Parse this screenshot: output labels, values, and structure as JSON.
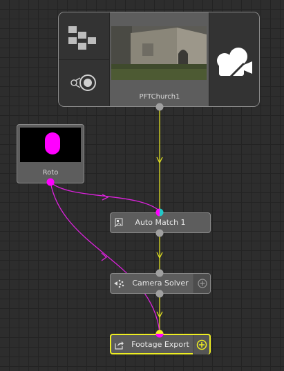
{
  "nodes": {
    "clip": {
      "label": "PFTChurch1"
    },
    "roto": {
      "label": "Roto"
    },
    "auto_match": {
      "label": "Auto Match 1"
    },
    "camera_solver": {
      "label": "Camera Solver"
    },
    "footage_export": {
      "label": "Footage Export"
    }
  },
  "colors": {
    "canvas": "#2d2d2d",
    "node_body": "#5d5d5d",
    "node_border": "#8a8a8a",
    "clip_wire": "#dddd22",
    "mask_wire": "#dd22dd",
    "selected_border": "#eeee22",
    "port": "#a0a0a0"
  },
  "icons": {
    "clip_mosaic": "mosaic-icon",
    "clip_lens": "lens-toggle-icon",
    "clip_camera": "movie-camera-icon",
    "auto_match": "auto-match-icon",
    "camera_solver": "camera-solver-icon",
    "footage_export": "export-icon",
    "add": "plus-circle-icon"
  }
}
